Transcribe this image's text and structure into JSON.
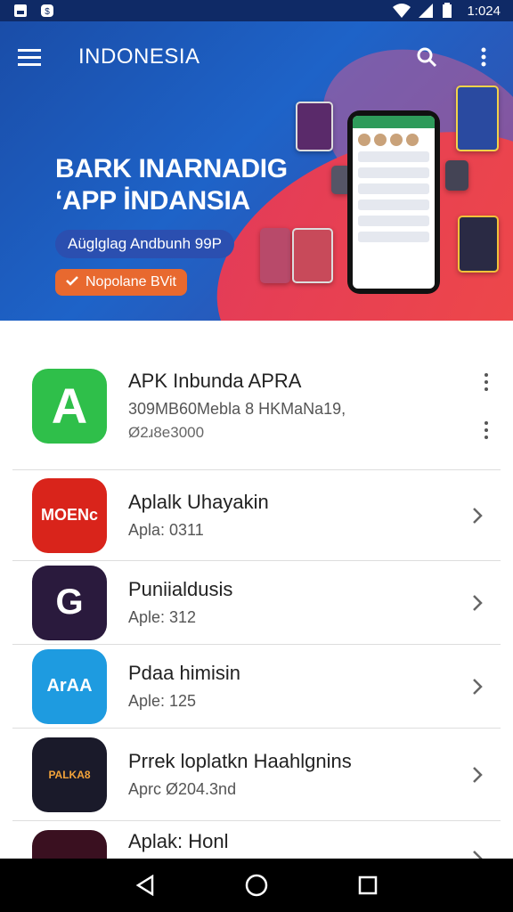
{
  "status_bar": {
    "time": "1:024"
  },
  "app_bar": {
    "title": "INDONESIA"
  },
  "hero": {
    "headline_line1": "BARK INARNADIG",
    "headline_line2": "‘APP İNDANSIA",
    "pill_text": "Aüglglag Andbunh 99P",
    "cta_text": "Nopolane BVit"
  },
  "carousel": {
    "dots": 3,
    "active_index": 1,
    "colors": [
      "#f2a36b",
      "#4aa8ff",
      "#ffffff"
    ]
  },
  "apps": [
    {
      "name": "APK Inbunda APRA",
      "meta": "309MB60Mebla 8 HKMaNa19,",
      "meta2": "Ø2ɹ8e3000",
      "icon_text": "A",
      "icon_bg": "#2fbf4a",
      "action": "kebab"
    },
    {
      "name": "Aplalk Uhayakin",
      "meta": "Apla: 0311",
      "icon_text": "MOENc",
      "icon_bg": "#d9241b",
      "action": "chevron"
    },
    {
      "name": "Puniialdusis",
      "meta": "Aple: 312",
      "icon_text": "G",
      "icon_bg": "#2a1a3d",
      "action": "chevron"
    },
    {
      "name": "Pdaa himisin",
      "meta": "Aple: 125",
      "icon_text": "ArAA",
      "icon_bg": "#1e9be0",
      "action": "chevron"
    },
    {
      "name": "Prrek loplatkn Haahlgnins",
      "meta": "Aprc Ø204.3nd",
      "icon_text": "PALKA8",
      "icon_bg": "#1a1a2a",
      "action": "chevron"
    },
    {
      "name": "Aplak: Honl",
      "meta": "",
      "icon_text": "",
      "icon_bg": "#3a1020",
      "action": "chevron"
    }
  ]
}
